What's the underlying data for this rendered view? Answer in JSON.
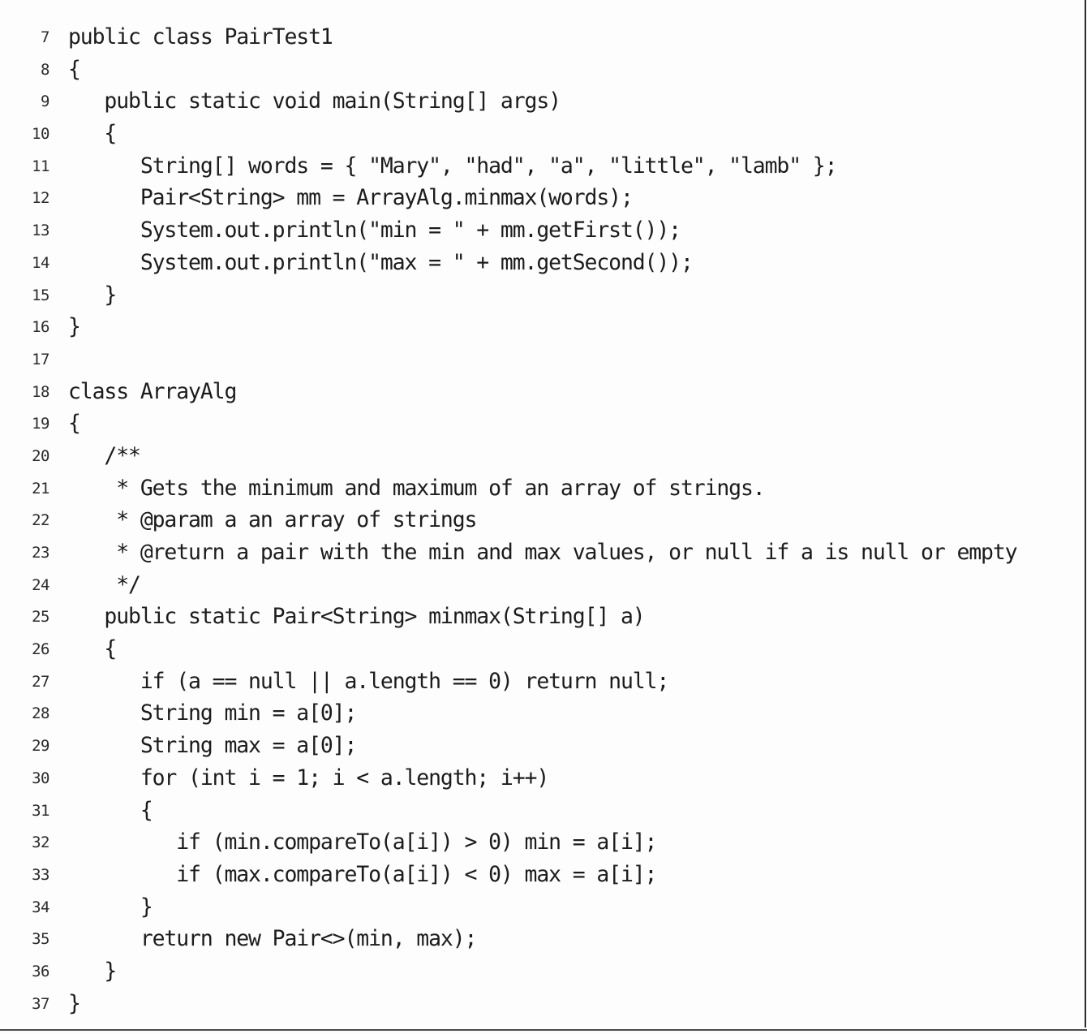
{
  "listing": {
    "lines": [
      {
        "number": "7",
        "code": "public class PairTest1"
      },
      {
        "number": "8",
        "code": "{"
      },
      {
        "number": "9",
        "code": "   public static void main(String[] args)"
      },
      {
        "number": "10",
        "code": "   {"
      },
      {
        "number": "11",
        "code": "      String[] words = { \"Mary\", \"had\", \"a\", \"little\", \"lamb\" };"
      },
      {
        "number": "12",
        "code": "      Pair<String> mm = ArrayAlg.minmax(words);"
      },
      {
        "number": "13",
        "code": "      System.out.println(\"min = \" + mm.getFirst());"
      },
      {
        "number": "14",
        "code": "      System.out.println(\"max = \" + mm.getSecond());"
      },
      {
        "number": "15",
        "code": "   }"
      },
      {
        "number": "16",
        "code": "}"
      },
      {
        "number": "17",
        "code": ""
      },
      {
        "number": "18",
        "code": "class ArrayAlg"
      },
      {
        "number": "19",
        "code": "{"
      },
      {
        "number": "20",
        "code": "   /**"
      },
      {
        "number": "21",
        "code": "    * Gets the minimum and maximum of an array of strings."
      },
      {
        "number": "22",
        "code": "    * @param a an array of strings"
      },
      {
        "number": "23",
        "code": "    * @return a pair with the min and max values, or null if a is null or empty"
      },
      {
        "number": "24",
        "code": "    */"
      },
      {
        "number": "25",
        "code": "   public static Pair<String> minmax(String[] a)"
      },
      {
        "number": "26",
        "code": "   {"
      },
      {
        "number": "27",
        "code": "      if (a == null || a.length == 0) return null;"
      },
      {
        "number": "28",
        "code": "      String min = a[0];"
      },
      {
        "number": "29",
        "code": "      String max = a[0];"
      },
      {
        "number": "30",
        "code": "      for (int i = 1; i < a.length; i++)"
      },
      {
        "number": "31",
        "code": "      {"
      },
      {
        "number": "32",
        "code": "         if (min.compareTo(a[i]) > 0) min = a[i];"
      },
      {
        "number": "33",
        "code": "         if (max.compareTo(a[i]) < 0) max = a[i];"
      },
      {
        "number": "34",
        "code": "      }"
      },
      {
        "number": "35",
        "code": "      return new Pair<>(min, max);"
      },
      {
        "number": "36",
        "code": "   }"
      },
      {
        "number": "37",
        "code": "}"
      }
    ]
  },
  "colors": {
    "text": "#1c1c1c",
    "line_numbers": "#2b2b2b",
    "background": "#fdfdfd"
  }
}
